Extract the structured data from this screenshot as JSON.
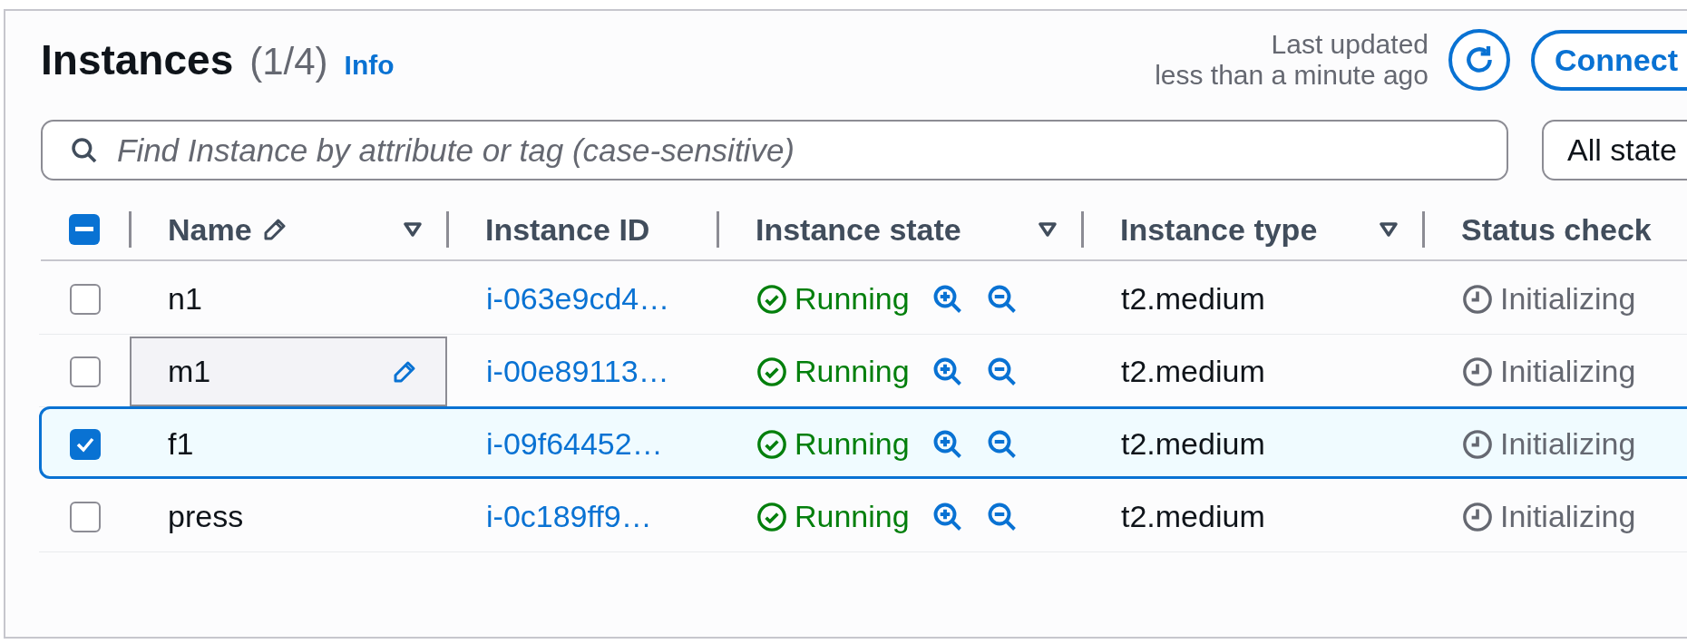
{
  "header": {
    "title": "Instances",
    "count": "(1/4)",
    "info": "Info",
    "last_updated": [
      "Last updated",
      "less than a minute ago"
    ],
    "connect_button": "Connect"
  },
  "search": {
    "placeholder": "Find Instance by attribute or tag (case-sensitive)"
  },
  "state_filter": {
    "value": "All state"
  },
  "table": {
    "select_all": {
      "indeterminate": true
    },
    "columns": [
      {
        "label": "Name",
        "editable": true,
        "filter": true
      },
      {
        "label": "Instance ID",
        "editable": false,
        "filter": false
      },
      {
        "label": "Instance state",
        "editable": false,
        "filter": true
      },
      {
        "label": "Instance type",
        "editable": false,
        "filter": true
      },
      {
        "label": "Status check",
        "editable": false
      }
    ],
    "rows": [
      {
        "name": "n1",
        "id": "i-063e9cd4…",
        "state": "Running",
        "type": "t2.medium",
        "status": "Initializing",
        "selected": false,
        "editing": false
      },
      {
        "name": "m1",
        "id": "i-00e89113…",
        "state": "Running",
        "type": "t2.medium",
        "status": "Initializing",
        "selected": false,
        "editing": true
      },
      {
        "name": "f1",
        "id": "i-09f64452…",
        "state": "Running",
        "type": "t2.medium",
        "status": "Initializing",
        "selected": true,
        "editing": false
      },
      {
        "name": "press",
        "id": "i-0c189ff9…",
        "state": "Running",
        "type": "t2.medium",
        "status": "Initializing",
        "selected": false,
        "editing": false
      }
    ]
  }
}
